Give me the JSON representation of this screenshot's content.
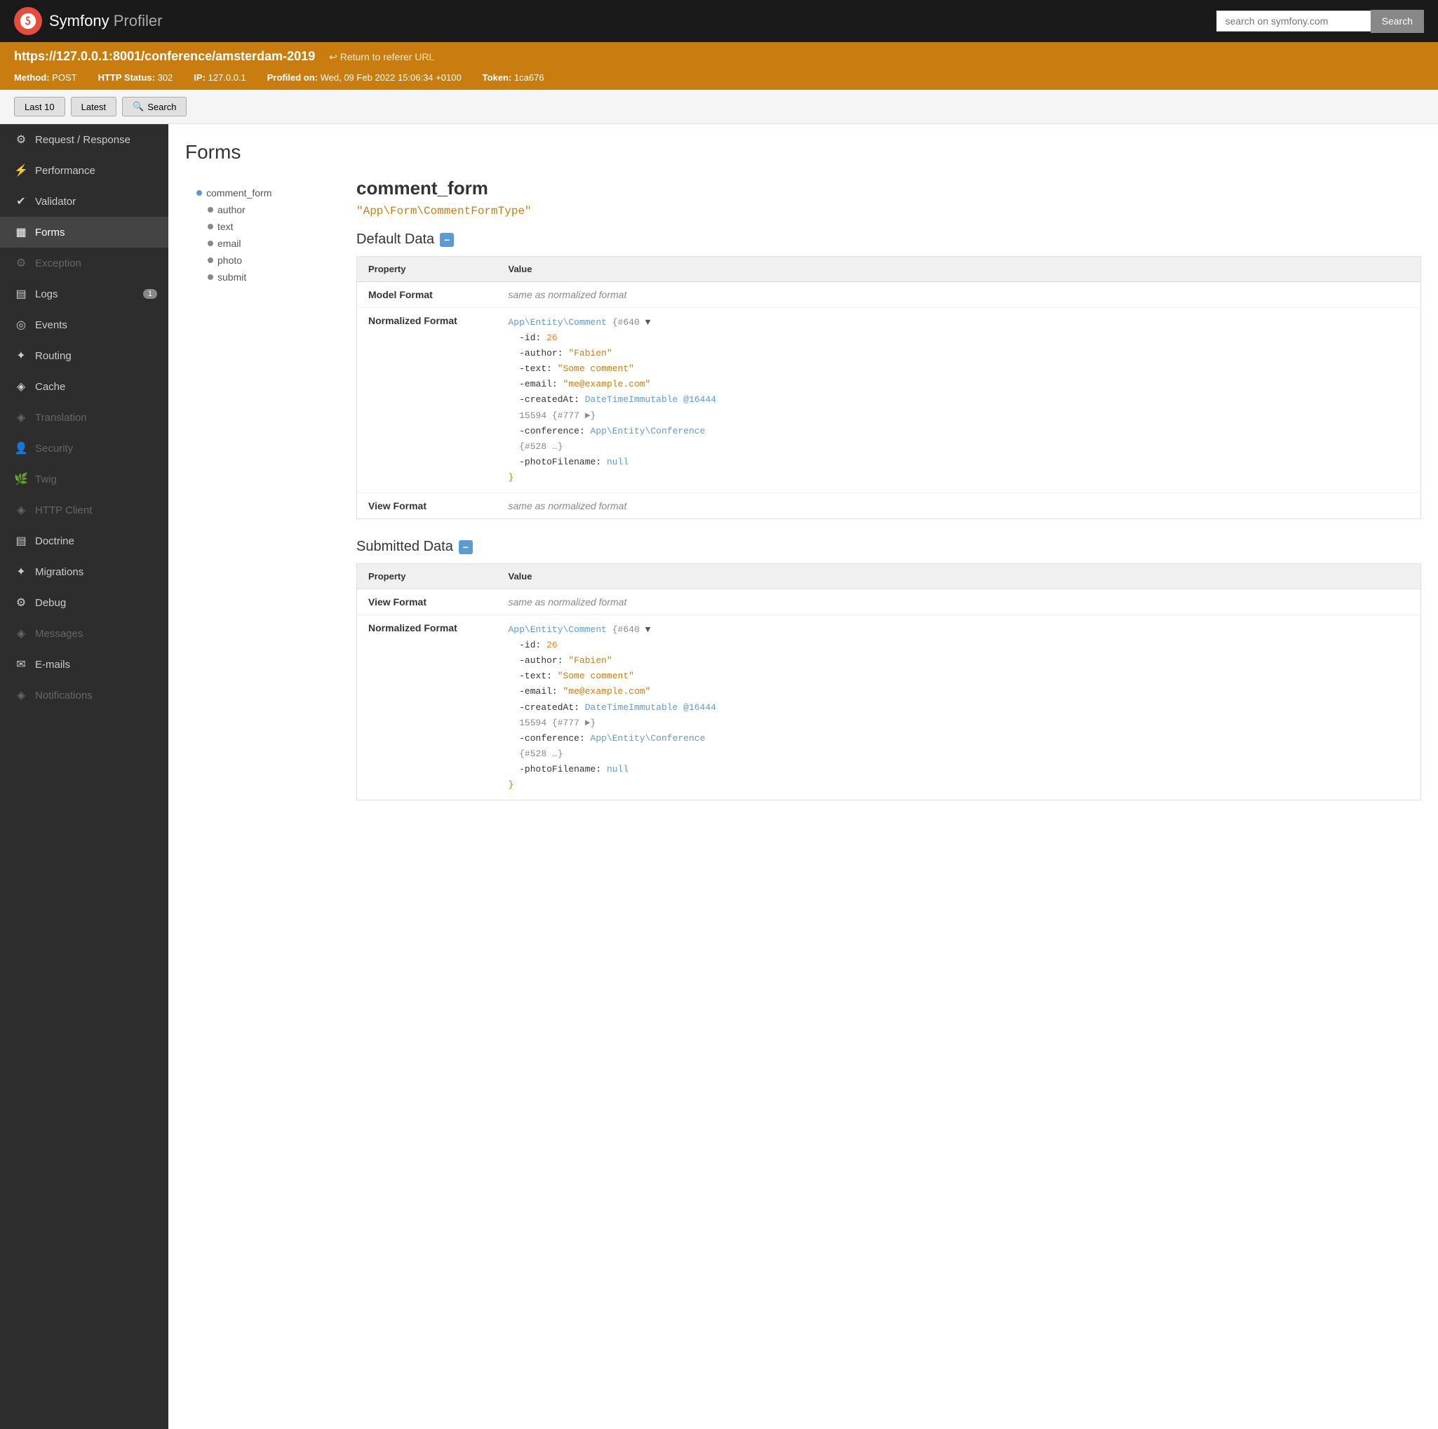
{
  "header": {
    "logo_text": "sf",
    "app_name": "Symfony",
    "app_sub": "Profiler",
    "search_placeholder": "search on symfony.com",
    "search_btn": "Search"
  },
  "url_bar": {
    "url": "https://127.0.0.1:8001/conference/amsterdam-2019",
    "return_label": "↩ Return to referer URL",
    "method_label": "Method:",
    "method_value": "POST",
    "status_label": "HTTP Status:",
    "status_value": "302",
    "ip_label": "IP:",
    "ip_value": "127.0.0.1",
    "profiled_label": "Profiled on:",
    "profiled_value": "Wed, 09 Feb 2022 15:06:34 +0100",
    "token_label": "Token:",
    "token_value": "1ca676"
  },
  "toolbar": {
    "btn_last10": "Last 10",
    "btn_latest": "Latest",
    "btn_search": "Search"
  },
  "sidebar": {
    "items": [
      {
        "id": "request-response",
        "label": "Request / Response",
        "icon": "⚙",
        "active": false,
        "disabled": false
      },
      {
        "id": "performance",
        "label": "Performance",
        "icon": "⚡",
        "active": false,
        "disabled": false
      },
      {
        "id": "validator",
        "label": "Validator",
        "icon": "✓",
        "active": false,
        "disabled": false
      },
      {
        "id": "forms",
        "label": "Forms",
        "icon": "☰",
        "active": true,
        "disabled": false
      },
      {
        "id": "exception",
        "label": "Exception",
        "icon": "⚙",
        "active": false,
        "disabled": true
      },
      {
        "id": "logs",
        "label": "Logs",
        "icon": "☰",
        "active": false,
        "disabled": false,
        "badge": "1"
      },
      {
        "id": "events",
        "label": "Events",
        "icon": "◎",
        "active": false,
        "disabled": false
      },
      {
        "id": "routing",
        "label": "Routing",
        "icon": "✦",
        "active": false,
        "disabled": false
      },
      {
        "id": "cache",
        "label": "Cache",
        "icon": "◈",
        "active": false,
        "disabled": false
      },
      {
        "id": "translation",
        "label": "Translation",
        "icon": "◈",
        "active": false,
        "disabled": true
      },
      {
        "id": "security",
        "label": "Security",
        "icon": "👤",
        "active": false,
        "disabled": true
      },
      {
        "id": "twig",
        "label": "Twig",
        "icon": "🌿",
        "active": false,
        "disabled": true
      },
      {
        "id": "http-client",
        "label": "HTTP Client",
        "icon": "◈",
        "active": false,
        "disabled": true
      },
      {
        "id": "doctrine",
        "label": "Doctrine",
        "icon": "☰",
        "active": false,
        "disabled": false
      },
      {
        "id": "migrations",
        "label": "Migrations",
        "icon": "✦",
        "active": false,
        "disabled": false
      },
      {
        "id": "debug",
        "label": "Debug",
        "icon": "⚙",
        "active": false,
        "disabled": false
      },
      {
        "id": "messages",
        "label": "Messages",
        "icon": "◈",
        "active": false,
        "disabled": true
      },
      {
        "id": "emails",
        "label": "E-mails",
        "icon": "✉",
        "active": false,
        "disabled": false
      },
      {
        "id": "notifications",
        "label": "Notifications",
        "icon": "◈",
        "active": false,
        "disabled": true
      }
    ]
  },
  "forms_page": {
    "title": "Forms",
    "tree": {
      "root": "comment_form",
      "children": [
        "author",
        "text",
        "email",
        "photo",
        "submit"
      ]
    },
    "selected_form": {
      "name": "comment_form",
      "type": "\"App\\Form\\CommentFormType\"",
      "default_data": {
        "section_title": "Default Data",
        "table_headers": [
          "Property",
          "Value"
        ],
        "rows": [
          {
            "property": "Model Format",
            "value_type": "muted",
            "value": "same as normalized format"
          },
          {
            "property": "Normalized Format",
            "value_type": "code",
            "code_lines": [
              {
                "text": "App\\Entity\\Comment",
                "class": "code-class",
                "suffix": " {#640 "
              },
              {
                "text": "▼",
                "class": "code-arrow"
              },
              {
                "text": ""
              },
              {
                "indent": 2,
                "key": "-id",
                "colon": ": ",
                "val": "26",
                "val_class": "code-num"
              },
              {
                "indent": 2,
                "key": "-author",
                "colon": ": ",
                "val": "\"Fabien\"",
                "val_class": "code-str"
              },
              {
                "indent": 2,
                "key": "-text",
                "colon": ": ",
                "val": "\"Some comment\"",
                "val_class": "code-str"
              },
              {
                "indent": 2,
                "key": "-email",
                "colon": ": ",
                "val": "\"me@example.com\"",
                "val_class": "code-str"
              },
              {
                "indent": 2,
                "key": "-createdAt",
                "colon": ": ",
                "val": "DateTimeImmutable @16444",
                "val_class": "code-class"
              },
              {
                "indent": 2,
                "text": "15594 {#777 ►}"
              },
              {
                "indent": 2,
                "key": "-conference",
                "colon": ": ",
                "val": "App\\Entity\\Conference",
                "val_class": "code-class"
              },
              {
                "indent": 2,
                "text": "{#528 …}"
              },
              {
                "indent": 2,
                "key": "-photoFilename",
                "colon": ": ",
                "val": "null",
                "val_class": "code-null"
              },
              {
                "text": "}",
                "class": "code-str"
              }
            ]
          },
          {
            "property": "View Format",
            "value_type": "muted",
            "value": "same as normalized format"
          }
        ]
      },
      "submitted_data": {
        "section_title": "Submitted Data",
        "table_headers": [
          "Property",
          "Value"
        ],
        "rows": [
          {
            "property": "View Format",
            "value_type": "muted",
            "value": "same as normalized format"
          },
          {
            "property": "Normalized Format",
            "value_type": "code",
            "code_lines": [
              {
                "text": "App\\Entity\\Comment",
                "class": "code-class",
                "suffix": " {#640 "
              },
              {
                "text": "▼",
                "class": "code-arrow"
              },
              {
                "text": ""
              },
              {
                "indent": 2,
                "key": "-id",
                "colon": ": ",
                "val": "26",
                "val_class": "code-num"
              },
              {
                "indent": 2,
                "key": "-author",
                "colon": ": ",
                "val": "\"Fabien\"",
                "val_class": "code-str"
              },
              {
                "indent": 2,
                "key": "-text",
                "colon": ": ",
                "val": "\"Some comment\"",
                "val_class": "code-str"
              },
              {
                "indent": 2,
                "key": "-email",
                "colon": ": ",
                "val": "\"me@example.com\"",
                "val_class": "code-str"
              },
              {
                "indent": 2,
                "key": "-createdAt",
                "colon": ": ",
                "val": "DateTimeImmutable @16444",
                "val_class": "code-class"
              },
              {
                "indent": 2,
                "text": "15594 {#777 ►}"
              },
              {
                "indent": 2,
                "key": "-conference",
                "colon": ": ",
                "val": "App\\Entity\\Conference",
                "val_class": "code-class"
              },
              {
                "indent": 2,
                "text": "{#528 …}"
              },
              {
                "indent": 2,
                "key": "-photoFilename",
                "colon": ": ",
                "val": "null",
                "val_class": "code-null"
              },
              {
                "text": "}",
                "class": "code-str"
              }
            ]
          }
        ]
      }
    }
  }
}
